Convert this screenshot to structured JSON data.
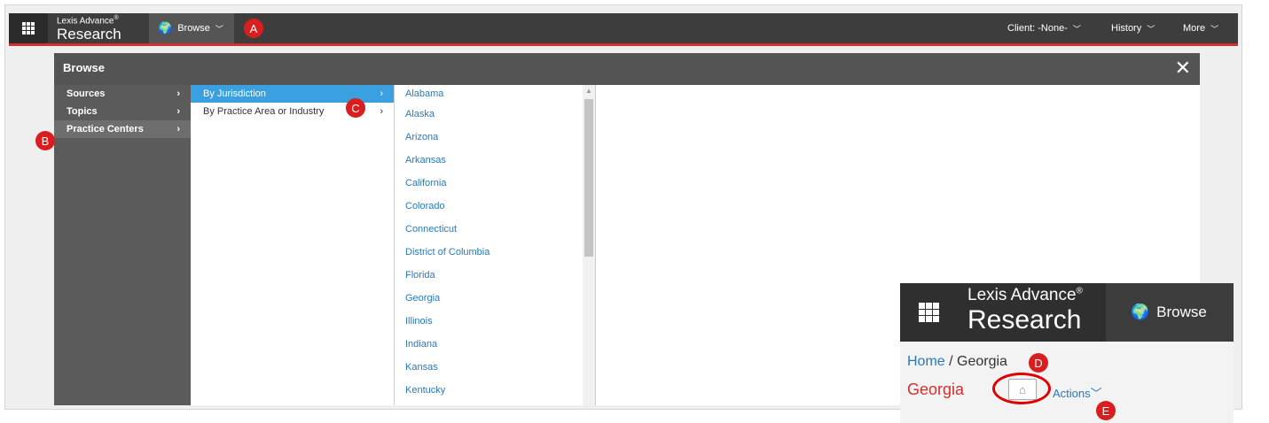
{
  "topbar": {
    "brand_small": "Lexis Advance",
    "brand_sup": "®",
    "brand_large": "Research",
    "browse_label": "Browse",
    "client_label": "Client: -None-",
    "history_label": "History",
    "more_label": "More"
  },
  "markers": {
    "a": "A",
    "b": "B",
    "c": "C",
    "d": "D",
    "e": "E"
  },
  "panel": {
    "title": "Browse",
    "col1": [
      {
        "label": "Sources"
      },
      {
        "label": "Topics"
      },
      {
        "label": "Practice Centers"
      }
    ],
    "col2": [
      {
        "label": "By Jurisdiction"
      },
      {
        "label": "By Practice Area or Industry"
      }
    ],
    "states": [
      "Alabama",
      "Alaska",
      "Arizona",
      "Arkansas",
      "California",
      "Colorado",
      "Connecticut",
      "District of Columbia",
      "Florida",
      "Georgia",
      "Illinois",
      "Indiana",
      "Kansas",
      "Kentucky"
    ]
  },
  "inset": {
    "brand_small": "Lexis Advance",
    "brand_sup": "®",
    "brand_large": "Research",
    "browse_label": "Browse",
    "crumb_home": "Home",
    "crumb_sep": " / ",
    "crumb_current": "Georgia",
    "page_title": "Georgia",
    "actions_label": "Actions"
  },
  "colors": {
    "accent": "#d32f2f",
    "link": "#2a79b8",
    "active": "#3aa0e0"
  }
}
